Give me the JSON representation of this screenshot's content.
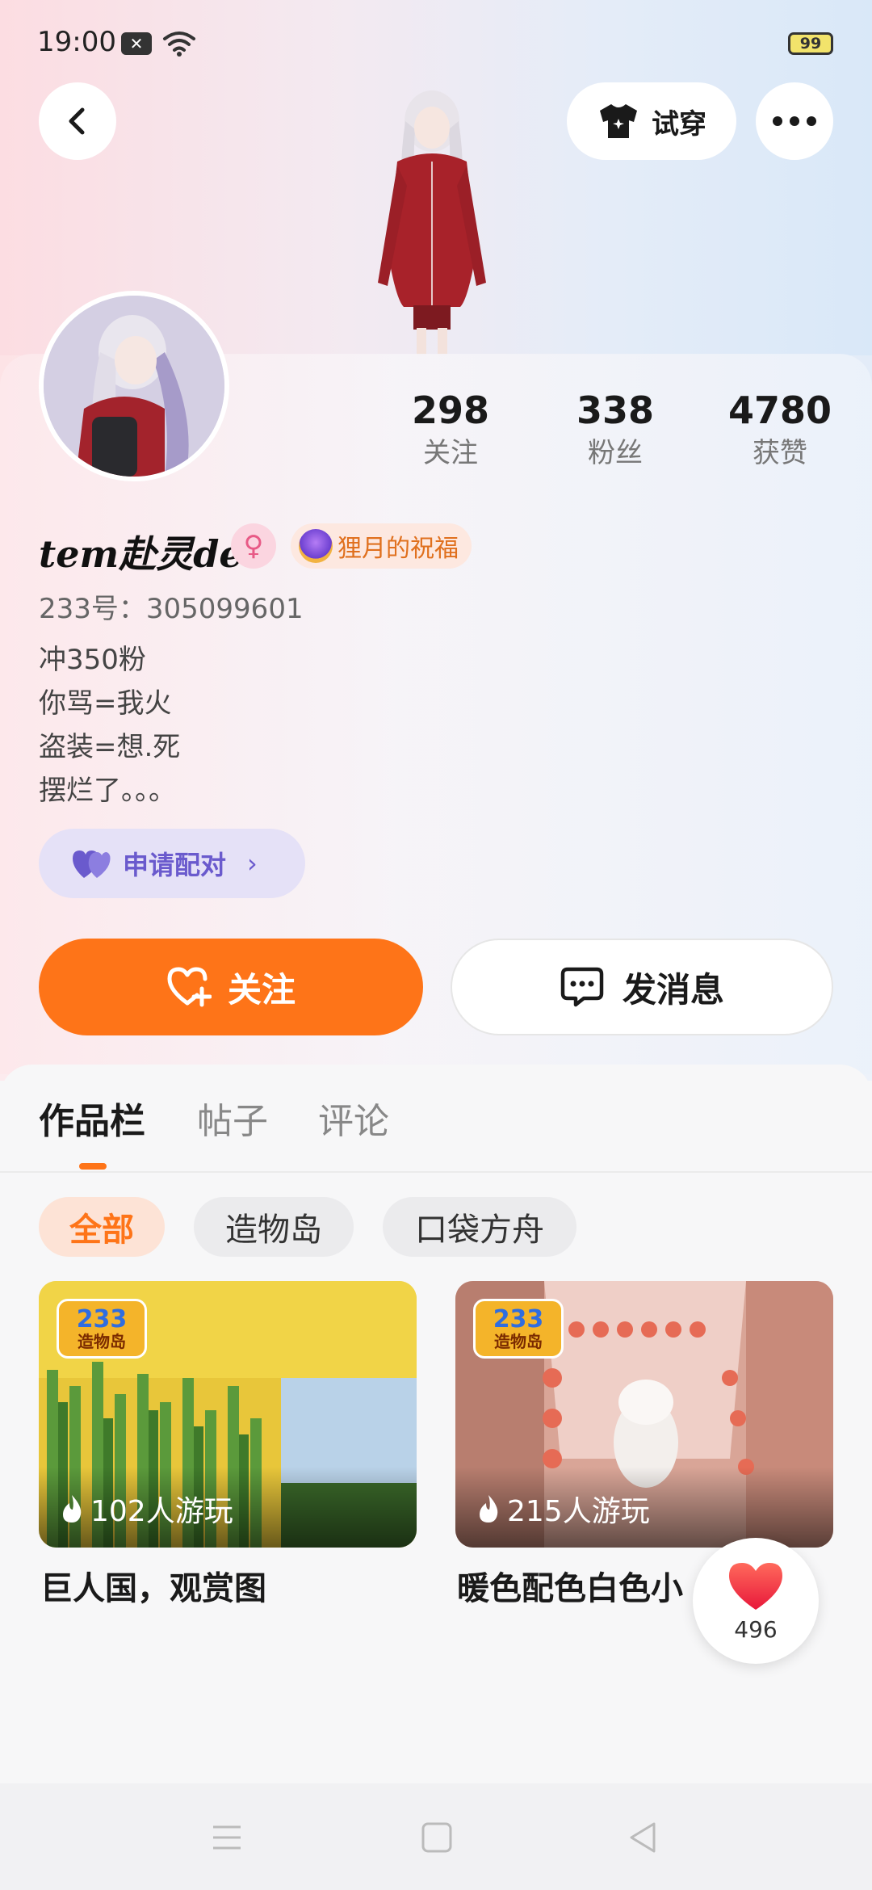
{
  "status_bar": {
    "time": "19:00",
    "battery": "99"
  },
  "header": {
    "tryon_label": "试穿"
  },
  "profile": {
    "stats": [
      {
        "value": "298",
        "label": "关注"
      },
      {
        "value": "338",
        "label": "粉丝"
      },
      {
        "value": "4780",
        "label": "获赞"
      }
    ],
    "nickname": "tem赴灵der",
    "title_badge": "狸月的祝福",
    "user_id": "233号：305099601",
    "bio": [
      "冲350粉",
      "你骂=我火",
      "盗装=想.死",
      "摆烂了。。。"
    ],
    "pair_button": "申请配对"
  },
  "actions": {
    "follow": "关注",
    "message": "发消息"
  },
  "tabs": [
    "作品栏",
    "帖子",
    "评论"
  ],
  "filters": [
    "全部",
    "造物岛",
    "口袋方舟"
  ],
  "works": [
    {
      "logo_number": "233",
      "logo_text": "造物岛",
      "plays": "102人游玩",
      "title": "巨人国，观赏图"
    },
    {
      "logo_number": "233",
      "logo_text": "造物岛",
      "plays": "215人游玩",
      "title": "暖色配色白色小"
    }
  ],
  "like_count": "496",
  "colors": {
    "accent": "#fe7418",
    "pair": "#6a5acd"
  }
}
